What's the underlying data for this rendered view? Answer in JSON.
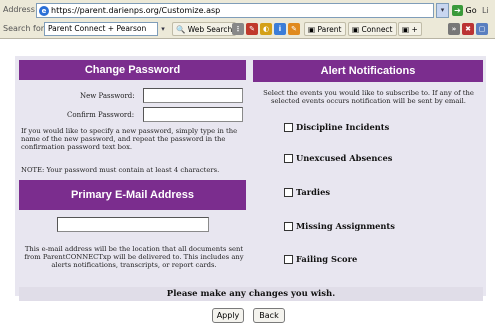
{
  "browser": {
    "address_label": "Address",
    "url": "https://parent.darienps.org/Customize.asp",
    "go_label": "Go",
    "links_label": "Li",
    "search_label": "Search for",
    "search_value": "Parent Connect + Pearson",
    "web_search_label": "Web Search",
    "toolbar_parent_label": "Parent",
    "toolbar_connect_label": "Connect",
    "toolbar_plus_label": "+"
  },
  "change_password": {
    "title": "Change Password",
    "new_password_label": "New Password:",
    "confirm_password_label": "Confirm Password:",
    "new_password_value": "",
    "confirm_password_value": "",
    "instructions": "If you would like to specify a new password, simply type in the name of the new password, and repeat the password in the confirmation password text box.",
    "note": "NOTE: Your password must contain at least 4 characters."
  },
  "email": {
    "title": "Primary E-Mail Address",
    "value": "",
    "description": "This e-mail address will be the location that all documents sent from ParentCONNECTxp will be delivered to.  This includes any alerts notifications, transcripts, or report cards."
  },
  "alerts": {
    "title": "Alert Notifications",
    "intro": "Select the events you would like to subscribe to.  If any of the selected events occurs notification will be sent by email.",
    "options": [
      {
        "label": "Discipline Incidents",
        "checked": false
      },
      {
        "label": "Unexcused Absences",
        "checked": false
      },
      {
        "label": "Tardies",
        "checked": false
      },
      {
        "label": "Missing Assignments",
        "checked": false
      },
      {
        "label": "Failing Score",
        "checked": false
      }
    ]
  },
  "footer_message": "Please make any changes you wish.",
  "buttons": {
    "apply": "Apply",
    "back": "Back"
  },
  "colors": {
    "panel_header": "#7b2d8e",
    "panel_background": "#e8e6f0"
  }
}
